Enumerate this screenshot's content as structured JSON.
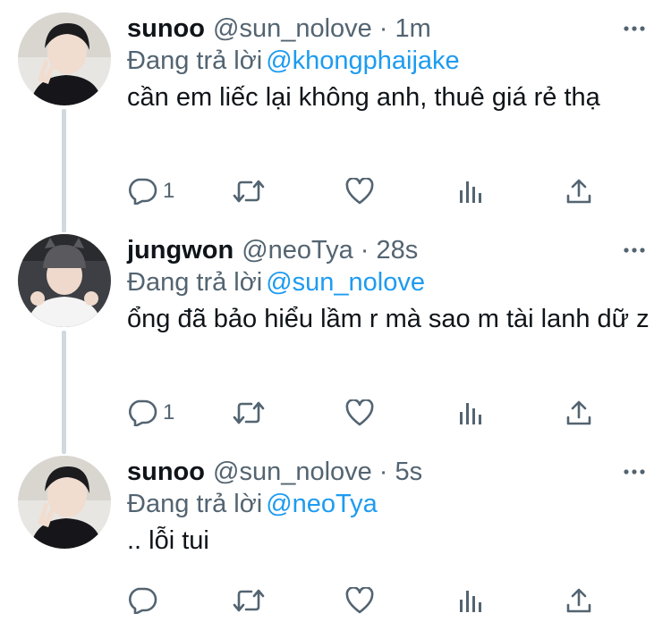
{
  "tweets": [
    {
      "name": "sunoo",
      "handle": "@sun_nolove",
      "separator": "·",
      "time": "1m",
      "replying_label": "Đang trả lời",
      "replying_to": "@khongphaijake",
      "text": "cần em liếc lại không anh, thuê giá rẻ thạ",
      "reply_count": "1",
      "avatar": "avatar-sunoo"
    },
    {
      "name": "jungwon",
      "handle": "@neoTya",
      "separator": "·",
      "time": "28s",
      "replying_label": "Đang trả lời",
      "replying_to": "@sun_nolove",
      "text": "ổng đã bảo hiểu lầm r mà sao m tài lanh dữ z",
      "reply_count": "1",
      "avatar": "avatar-jungwon"
    },
    {
      "name": "sunoo",
      "handle": "@sun_nolove",
      "separator": "·",
      "time": "5s",
      "replying_label": "Đang trả lời",
      "replying_to": "@neoTya",
      "text": ".. lỗi tui",
      "reply_count": "",
      "avatar": "avatar-sunoo"
    }
  ],
  "icons": {
    "reply": "reply-icon",
    "retweet": "retweet-icon",
    "like": "like-icon",
    "views": "views-icon",
    "share": "share-icon",
    "more": "more-icon"
  },
  "colors": {
    "text_primary": "#0f1419",
    "text_secondary": "#536471",
    "mention": "#1d9bf0",
    "thread_line": "#cfd9de"
  }
}
